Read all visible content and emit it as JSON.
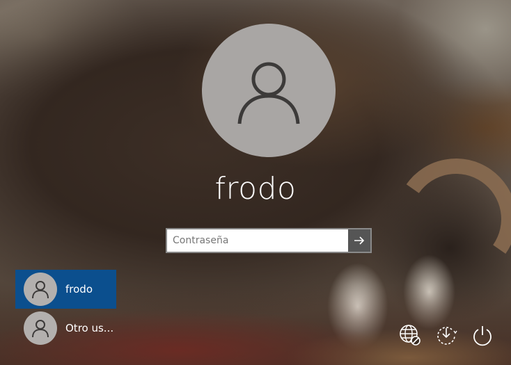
{
  "user": {
    "name": "frodo"
  },
  "password": {
    "placeholder": "Contraseña"
  },
  "user_list": [
    {
      "name": "frodo",
      "selected": true
    },
    {
      "name": "Otro us...",
      "selected": false
    }
  ],
  "icons": {
    "avatar": "user-silhouette-icon",
    "submit": "arrow-right-icon",
    "network": "network-globe-icon",
    "accessibility": "accessibility-icon",
    "power": "power-icon"
  },
  "colors": {
    "selected_user": "#0b4f8e",
    "avatar_bg": "#a9a6a4",
    "submit_bg": "#555555"
  }
}
